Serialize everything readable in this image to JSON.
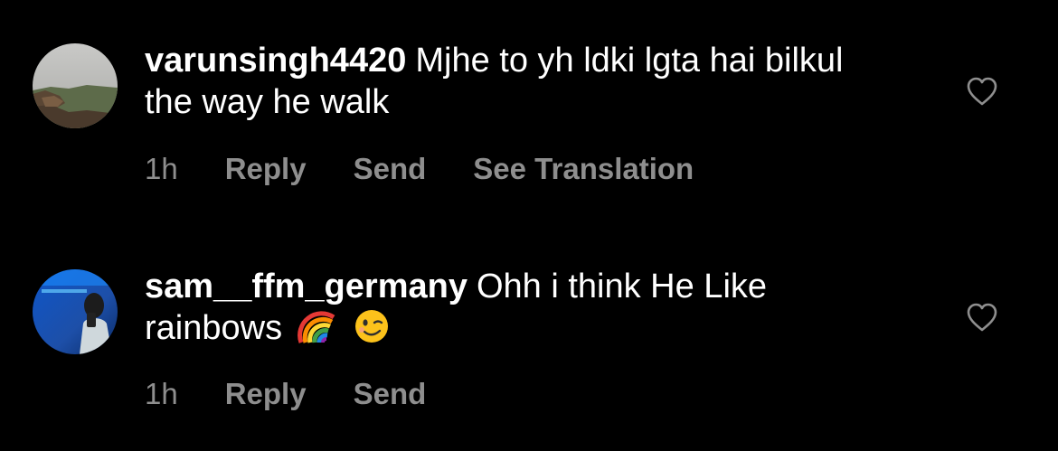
{
  "comments": [
    {
      "username": "varunsingh4420",
      "text": "Mjhe to yh ldki lgta hai bilkul the way he walk",
      "time": "1h",
      "actions": [
        "Reply",
        "Send",
        "See Translation"
      ],
      "like_icon": "heart-outline-icon",
      "avatar_icon": "landscape-photo"
    },
    {
      "username": "sam__ffm_germany",
      "text": "Ohh i think He Like rainbows",
      "emojis": [
        "rainbow-emoji",
        "winking-face-emoji"
      ],
      "time": "1h",
      "actions": [
        "Reply",
        "Send"
      ],
      "like_icon": "heart-outline-icon",
      "avatar_icon": "person-photo"
    }
  ],
  "colors": {
    "background": "#000000",
    "primary_text": "#ffffff",
    "secondary_text": "#8e8e8e"
  }
}
